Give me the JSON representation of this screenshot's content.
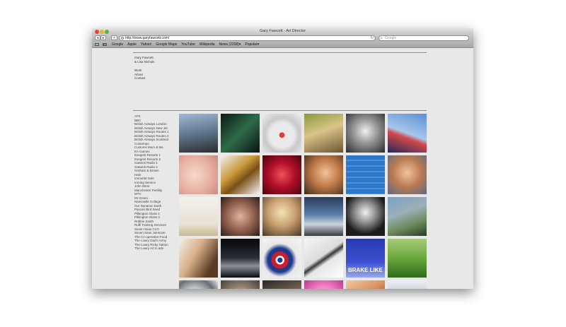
{
  "window": {
    "title": "Gary Fawcett - Art Director"
  },
  "toolbar": {
    "back_label": "◂",
    "forward_label": "▸",
    "add_label": "+",
    "url": "http://www.garyfawcett.com/",
    "search_placeholder": "Google"
  },
  "bookmarks": [
    "Google",
    "Apple",
    "Yahoo!",
    "Google Maps",
    "YouTube",
    "Wikipedia",
    "News (2208)▾",
    "Popular▾"
  ],
  "sidebar": {
    "names": [
      "Gary Fawcett",
      "& Lisa Nichols"
    ],
    "nav": [
      "Work",
      "About",
      "Contact"
    ],
    "clients": [
      "ATS",
      "BBC",
      "British Airways London",
      "British Airways New Jet",
      "British Airways Routes 1",
      "British Airways Routes 2",
      "British Airways Scotland",
      "Contempo",
      "Customs Mum & Me",
      "EA Games",
      "Exegent Resorts 1",
      "Exegent Resorts 2",
      "Gatwick Radio 1",
      "Gatwick Radio 2",
      "Graham & Brown",
      "Halo",
      "Immortal Sole",
      "Ironing Service",
      "John West",
      "Manchester Fertility",
      "MTV",
      "Mr Green",
      "Newcastle College",
      "Our Dynamic Earth",
      "Pascan Bird Seed",
      "Pilkington Glass 1",
      "Pilkington Glass 2",
      "Robbie Smith",
      "Ruffi Training Services",
      "Seven Seas CLO",
      "Seven Seas Jointcare",
      "The Co-operative Food",
      "The Lowry Dad's Army",
      "The Lowry Ricky Hatton",
      "The Lowry Art in ads"
    ]
  },
  "grid": [
    {
      "name": "clock-tower-tile",
      "bg": "linear-gradient(170deg,#9fb9d6 0%,#5a6f84 55%,#2b2b2b 100%)"
    },
    {
      "name": "green-tunnel-tile",
      "bg": "linear-gradient(135deg,#0b1a12 0%,#2e6b4a 50%,#0a1410 100%)"
    },
    {
      "name": "swiss-knife-tile",
      "bg": "radial-gradient(circle at 50% 55%,#e03a3a 0 9%,#eaeaea 10% 42%,#c9c9c9 60%,#efefef 100%)"
    },
    {
      "name": "birds-tile",
      "bg": "linear-gradient(160deg,#8a9a3a 0%,#d9c48a 45%,#6b5530 100%)"
    },
    {
      "name": "laughing-man-tile",
      "bg": "radial-gradient(circle at 50% 45%,#f0f0f0 0%,#9a9a9a 40%,#2a2a2a 100%)"
    },
    {
      "name": "airplane-tail-tile",
      "bg": "linear-gradient(200deg,#5b8fd6 0%,#a8c6ea 50%,#d24848 60%,#1f2a5c 100%)"
    },
    {
      "name": "sleeping-baby-tile",
      "bg": "radial-gradient(circle at 40% 50%,#f7d9cd 0%,#e7b1a3 55%,#c98a7f 100%)"
    },
    {
      "name": "gold-letters-tile",
      "bg": "linear-gradient(140deg,#f2f2f2 0%,#c89a3a 40%,#7a4f15 60%,#f5f5f5 100%)"
    },
    {
      "name": "red-rose-tile",
      "bg": "radial-gradient(circle at 50% 50%,#f0515b 0%,#b3102a 45%,#4a0410 100%)"
    },
    {
      "name": "woman-portrait-tile",
      "bg": "radial-gradient(circle at 55% 45%,#f2c29a 0%,#c07a48 45%,#3a2a1c 100%)"
    },
    {
      "name": "blue-jet-tile",
      "bg": "repeating-linear-gradient(180deg,#2d78c8 0 6px,#4d93dc 6px 8px)"
    },
    {
      "name": "moustache-man-tile",
      "bg": "radial-gradient(circle at 50% 45%,#f4c3a0 0%,#b87a52 50%,#5c6a86 100%)"
    },
    {
      "name": "easel-chair-tile",
      "bg": "linear-gradient(180deg,#f4f1ea 0%,#e7e1d3 70%,#c9b890 100%)"
    },
    {
      "name": "woman-face-tile",
      "bg": "radial-gradient(circle at 50% 50%,#e0b39a 0%,#8a5a4a 55%,#2a1e1a 100%)"
    },
    {
      "name": "blonde-woman-tile",
      "bg": "radial-gradient(circle at 50% 40%,#f5e0b8 0%,#c9a070 45%,#4a3525 100%)"
    },
    {
      "name": "police-van-tile",
      "bg": "linear-gradient(180deg,#2a3b5c 0%,#5a7fa8 45%,#c9d3de 70%,#3a3a3a 100%)"
    },
    {
      "name": "microphone-tile",
      "bg": "radial-gradient(circle at 50% 40%,#f0f0f0 0%,#8c8c8c 35%,#1c1c1c 70%)"
    },
    {
      "name": "crowd-runner-tile",
      "bg": "linear-gradient(160deg,#7aa0c8 0%,#9bb0b8 40%,#6a8a5a 70%,#2c3a2a 100%)"
    },
    {
      "name": "woman-profile-tile",
      "bg": "linear-gradient(120deg,#f2f0ea 0%,#d8b08a 40%,#5a3a25 80%)"
    },
    {
      "name": "dark-shoe-tile",
      "bg": "linear-gradient(180deg,#050608 0%,#2a2e36 50%,#8a8f98 70%,#0a0b0e 100%)"
    },
    {
      "name": "union-jack-tile",
      "bg": "radial-gradient(circle at 45% 55%,#1f3a8c 0 8%,#ffffff 9% 14%,#c81e2e 15% 28%,#1f3a8c 29% 40%,#e8e8e8 55%,#f5f5f5 100%)"
    },
    {
      "name": "pen-tile",
      "bg": "linear-gradient(145deg,#f5f5f5 0%,#dcdcdc 45%,#3a3a3a 52%,#e6e6e6 60%,#ffffff 100%)"
    },
    {
      "name": "brake-poster-tile",
      "bg": "linear-gradient(180deg,#2a3bb0 0%,#3b4fd0 60%,#9aa8e8 100%)",
      "label": "BRAKE LIKE"
    },
    {
      "name": "golf-course-tile",
      "bg": "linear-gradient(180deg,#a8c97a 0%,#6aa83c 50%,#2e6a1c 100%)"
    },
    {
      "name": "steel-bowl-tile",
      "bg": "radial-gradient(circle at 40% 50%,#ffffff 0%,#bfc4c8 40%,#6a6e72 70%,#e8eaec 100%)"
    },
    {
      "name": "young-man-tile",
      "bg": "radial-gradient(circle at 50% 45%,#d8c8b8 0%,#8a7a6a 45%,#3a3430 100%)"
    },
    {
      "name": "hands-tile",
      "bg": "linear-gradient(160deg,#2a2622 0%,#7a6a5a 45%,#d0c0b0 70%,#3a3430 100%)"
    },
    {
      "name": "pink-pig-tile",
      "bg": "radial-gradient(circle at 50% 45%,#ffd0ea 0%,#f07ac0 45%,#b02a80 100%)"
    },
    {
      "name": "drinking-glass-tile",
      "bg": "linear-gradient(150deg,#f0c9a0 0%,#d89060 40%,#8a3a2a 70%,#2a1810 100%)"
    },
    {
      "name": "cheering-man-tile",
      "bg": "linear-gradient(180deg,#eef0f4 0%,#b9c2cc 45%,#4a5260 80%,#2a2e36 100%)"
    }
  ]
}
